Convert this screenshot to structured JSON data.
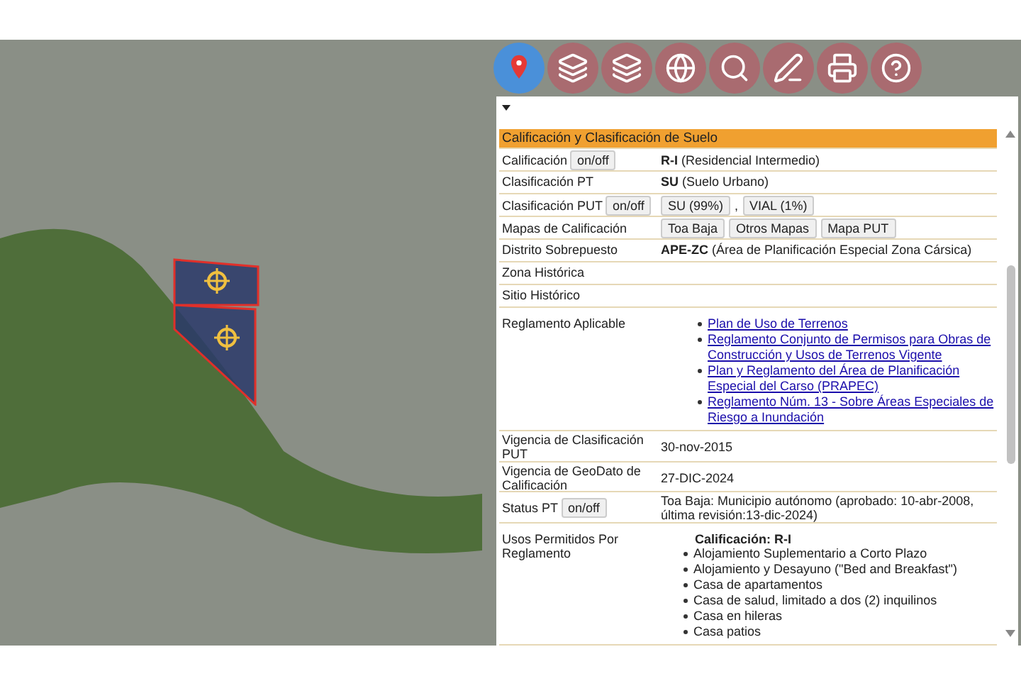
{
  "panel": {
    "header": "Calificación y Clasificación de Suelo",
    "rows": [
      {
        "kind": "text",
        "label": "Calificación",
        "toggle": "on/off",
        "value": "**R-I** (Residencial Intermedio)"
      },
      {
        "kind": "text",
        "label": "Clasificación PT",
        "value": "**SU** (Suelo Urbano)"
      },
      {
        "kind": "buttons",
        "label": "Clasificación PUT",
        "toggle": "on/off",
        "buttons": [
          "SU (99%)",
          "VIAL (1%)"
        ],
        "separator": ","
      },
      {
        "kind": "buttons",
        "label": "Mapas de Calificación",
        "buttons": [
          "Toa Baja",
          "Otros Mapas",
          "Mapa PUT"
        ]
      },
      {
        "kind": "text",
        "label": "Distrito Sobrepuesto",
        "value": "**APE-ZC** (Área de Planificación Especial Zona Cársica)"
      },
      {
        "kind": "text",
        "label": "Zona Histórica"
      },
      {
        "kind": "text",
        "label": "Sitio Histórico"
      },
      {
        "kind": "links",
        "label": "Reglamento Aplicable",
        "links": [
          "Plan de Uso de Terrenos",
          "Reglamento Conjunto de Permisos para Obras de Construcción y Usos de Terrenos Vigente",
          "Plan y Reglamento del Área de Planificación Especial del Carso (PRAPEC)",
          "Reglamento Núm. 13 - Sobre Áreas Especiales de Riesgo a Inundación"
        ]
      },
      {
        "kind": "text",
        "label": "Vigencia de Clasificación PUT",
        "value": "30-nov-2015"
      },
      {
        "kind": "text",
        "label": "Vigencia de GeoDato de Calificación",
        "value": "27-DIC-2024"
      },
      {
        "kind": "text",
        "label": "Status PT",
        "toggle": "on/off",
        "value": "Toa Baja: Municipio autónomo (aprobado: 10-abr-2008, última revisión:13-dic-2024)"
      },
      {
        "kind": "list",
        "label": "Usos Permitidos Por Reglamento",
        "heading": "Calificación: R-I",
        "items": [
          "Alojamiento Suplementario a Corto Plazo",
          "Alojamiento y Desayuno (\"Bed and Breakfast\")",
          "Casa de apartamentos",
          "Casa de salud, limitado a dos (2) inquilinos",
          "Casa en hileras",
          "Casa patios"
        ]
      }
    ]
  }
}
